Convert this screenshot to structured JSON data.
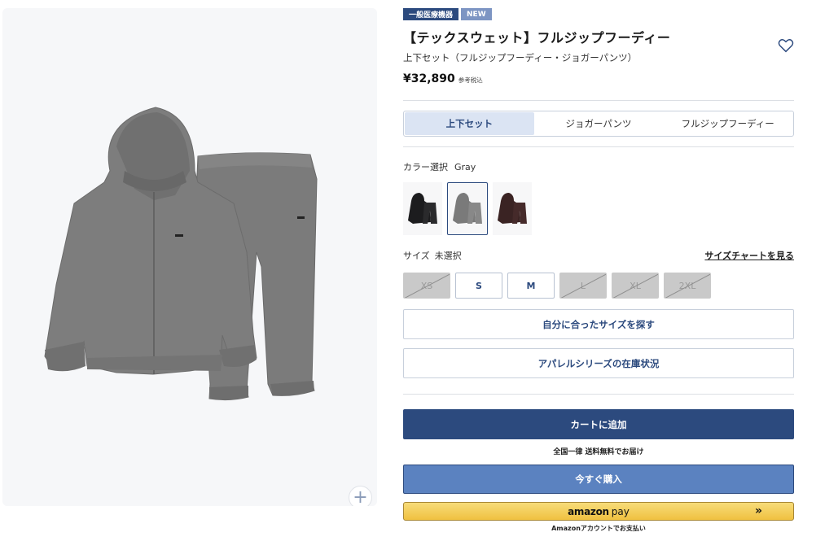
{
  "product": {
    "badges": [
      "一般医療機器",
      "NEW"
    ],
    "title": "【テックスウェット】フルジップフーディー",
    "subtitle": "上下セット（フルジップフーディー・ジョガーパンツ）",
    "price": "¥32,890",
    "tax_note": "参考税込"
  },
  "variant_tabs": [
    "上下セット",
    "ジョガーパンツ",
    "フルジップフーディー"
  ],
  "selected_tab": "上下セット",
  "color": {
    "label": "カラー選択",
    "selected_value": "Gray",
    "options": [
      {
        "name": "black",
        "hex": "#1c1c1e"
      },
      {
        "name": "gray",
        "hex": "#7a7a7a"
      },
      {
        "name": "brown",
        "hex": "#3a2323"
      }
    ]
  },
  "size": {
    "label": "サイズ",
    "selected_value": "未選択",
    "chart_link": "サイズチャートを見る",
    "options": [
      {
        "label": "XS",
        "available": false
      },
      {
        "label": "S",
        "available": true
      },
      {
        "label": "M",
        "available": true
      },
      {
        "label": "L",
        "available": false
      },
      {
        "label": "XL",
        "available": false
      },
      {
        "label": "2XL",
        "available": false
      }
    ]
  },
  "find_size_button": "自分に合ったサイズを探す",
  "stock_button": "アパレルシリーズの在庫状況",
  "cart_button": "カートに追加",
  "shipping_note": "全国一律 送料無料でお届け",
  "buy_now_button": "今すぐ購入",
  "amazon_pay": {
    "logo": "amazon",
    "pay": "pay",
    "arrow": "»",
    "note": "Amazonアカウントでお支払い"
  },
  "icons": {
    "favorite": "heart-icon",
    "zoom": "plus-icon"
  },
  "colors": {
    "brand": "#2c4a7e",
    "accent_light": "#5b82c0",
    "amazon": "#f0c140"
  }
}
